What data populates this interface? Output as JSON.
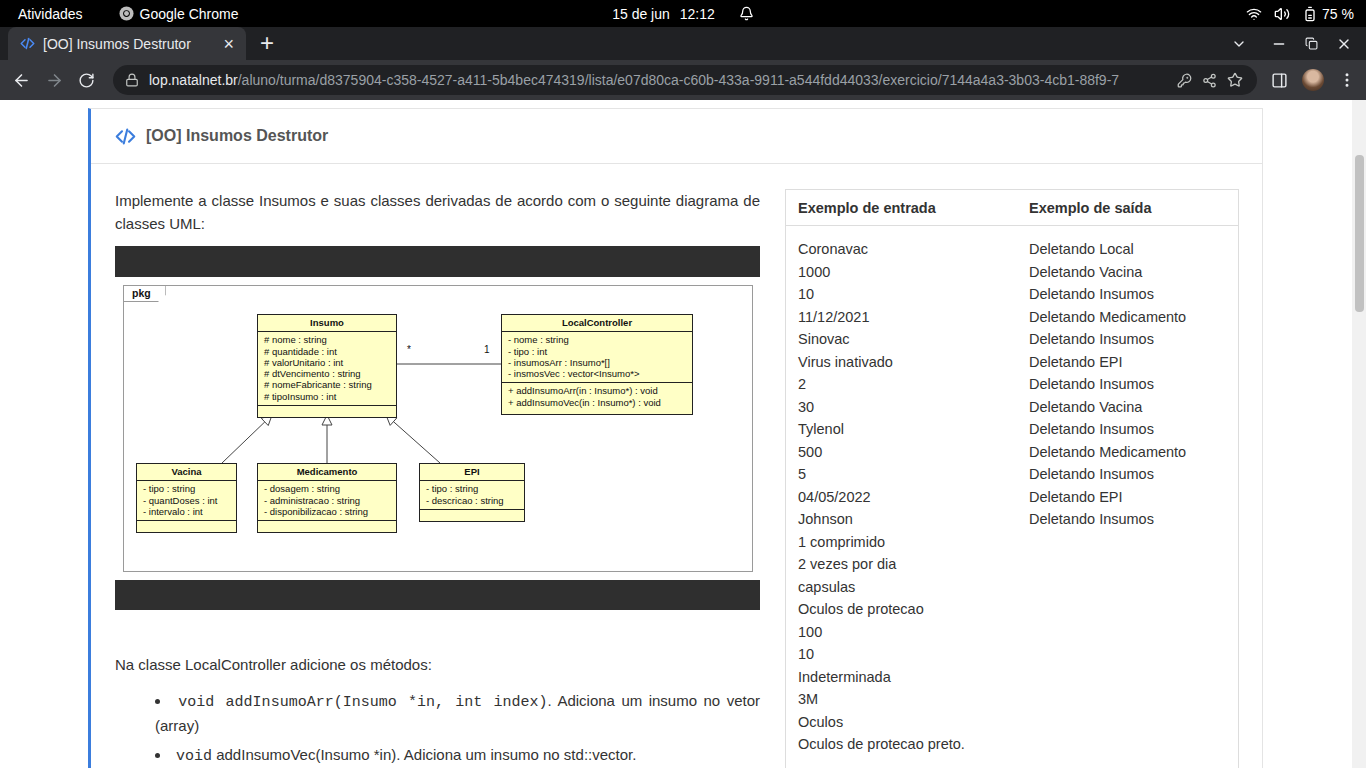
{
  "system_bar": {
    "activities": "Atividades",
    "app": "Google Chrome",
    "date": "15 de jun",
    "time": "12:12",
    "battery": "75 %"
  },
  "tabs": [
    {
      "label": "[OO] Insumos Destrutor",
      "close": "×",
      "selected": true
    }
  ],
  "new_tab": "+",
  "address_bar": {
    "host": "lop.natalnet.br",
    "path": "/aluno/turma/d8375904-c358-4527-a411-5b4bec474319/lista/e07d80ca-c60b-433a-9911-a544fdd44033/exercicio/7144a4a3-3b03-4cb1-88f9-7"
  },
  "exercise": {
    "title": "[OO] Insumos Destrutor",
    "intro": "Implemente a classe Insumos e suas classes derivadas de acordo com o seguinte diagrama de classes UML:",
    "diagram": {
      "frame_label": "pkg",
      "classes": [
        {
          "name": "Insumo",
          "attributes": [
            "# nome : string",
            "# quantidade : int",
            "# valorUnitario : int",
            "# dtVencimento : string",
            "# nomeFabricante : string",
            "# tipoInsumo : int"
          ],
          "methods": []
        },
        {
          "name": "LocalController",
          "attributes": [
            "- nome : string",
            "- tipo : int",
            "- insumosArr : Insumo*[]",
            "- insmosVec : vector<Insumo*>"
          ],
          "methods": [
            "+ addInsumoArr(in : Insumo*) : void",
            "+ addInsumoVec(in : Insumo*) : void"
          ]
        },
        {
          "name": "Vacina",
          "attributes": [
            "- tipo : string",
            "- quantDoses : int",
            "- intervalo : int"
          ],
          "methods": []
        },
        {
          "name": "Medicamento",
          "attributes": [
            "- dosagem : string",
            "- administracao : string",
            "- disponibilizacao : string"
          ],
          "methods": []
        },
        {
          "name": "EPI",
          "attributes": [
            "- tipo : string",
            "- descricao : string"
          ],
          "methods": []
        }
      ],
      "association": {
        "from": "Insumo",
        "to": "LocalController",
        "from_multiplicity": "*",
        "to_multiplicity": "1"
      },
      "generalizations": [
        {
          "child": "Vacina",
          "parent": "Insumo"
        },
        {
          "child": "Medicamento",
          "parent": "Insumo"
        },
        {
          "child": "EPI",
          "parent": "Insumo"
        }
      ]
    },
    "methods_intro": "Na classe LocalController adicione os métodos:",
    "methods": [
      {
        "code": "void addInsumoArr(Insumo *in, int index)",
        "text": ". Adiciona um insumo no vetor (array)"
      },
      {
        "code": "void",
        "text": " addInsumoVec(Insumo *in). Adiciona um insumo no std::vector."
      }
    ]
  },
  "examples": {
    "input_header": "Exemplo de entrada",
    "output_header": "Exemplo de saída",
    "input": [
      "Coronavac",
      "1000",
      "10",
      "11/12/2021",
      "Sinovac",
      "Virus inativado",
      "2",
      "30",
      "Tylenol",
      "500",
      "5",
      "04/05/2022",
      "Johnson",
      "1 comprimido",
      "2 vezes por dia",
      "capsulas",
      "Oculos de protecao",
      "100",
      "10",
      "Indeterminada",
      "3M",
      "Oculos",
      "Oculos de protecao preto."
    ],
    "output": [
      "Deletando Local",
      "Deletando Vacina",
      "Deletando Insumos",
      "Deletando Medicamento",
      "Deletando Insumos",
      "Deletando EPI",
      "Deletando Insumos",
      "Deletando Vacina",
      "Deletando Insumos",
      "Deletando Medicamento",
      "Deletando Insumos",
      "Deletando EPI",
      "Deletando Insumos"
    ]
  }
}
